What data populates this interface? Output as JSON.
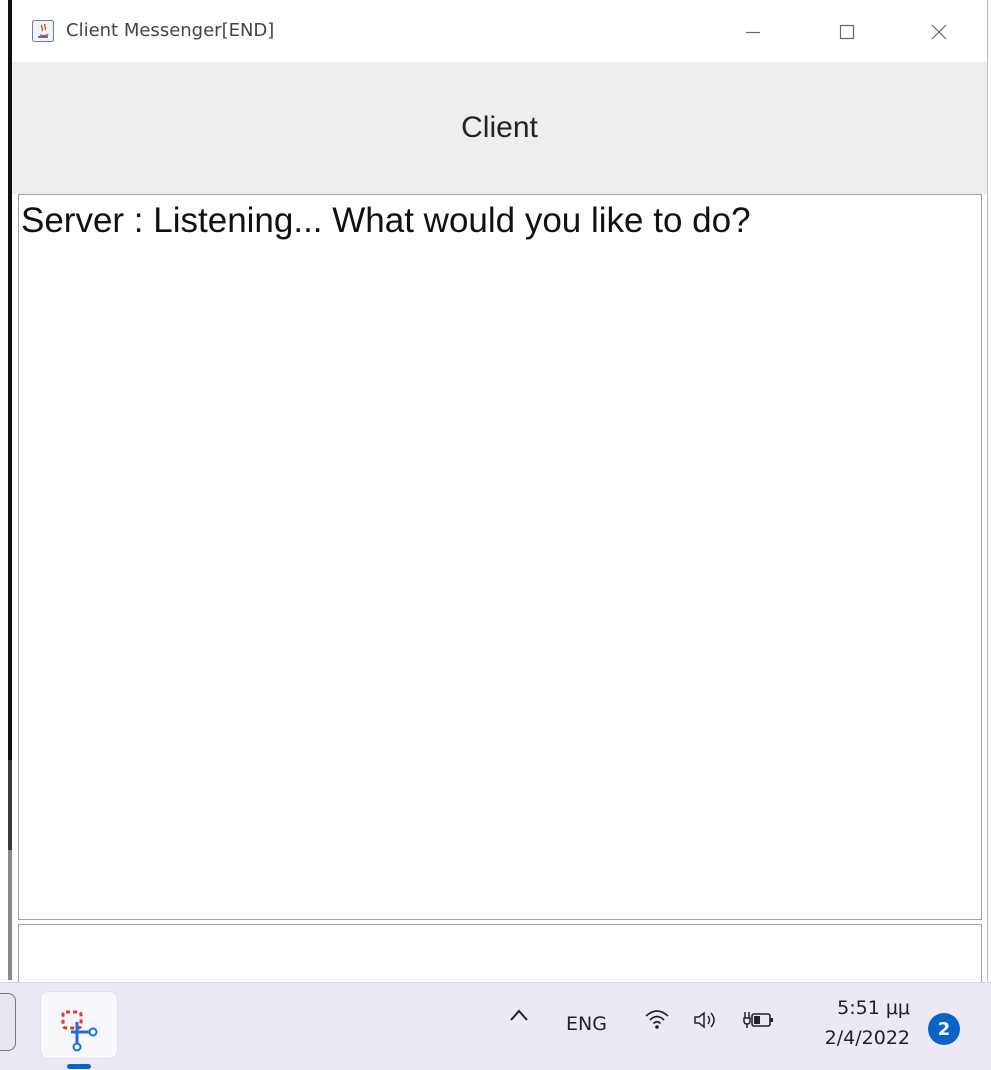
{
  "window": {
    "title": "Client Messenger[END]",
    "controls": {
      "minimize_icon": "minimize-icon",
      "maximize_icon": "maximize-icon",
      "close_icon": "close-icon"
    }
  },
  "header": {
    "label": "Client"
  },
  "chat": {
    "messages": [
      "Server : Listening... What would you like to do?"
    ]
  },
  "input": {
    "value": ""
  },
  "taskbar": {
    "app_icon": "snipping-tool-icon",
    "language": "ENG",
    "time": "5:51 μμ",
    "date": "2/4/2022",
    "notification_count": "2",
    "accent_color": "#0a63c9"
  }
}
